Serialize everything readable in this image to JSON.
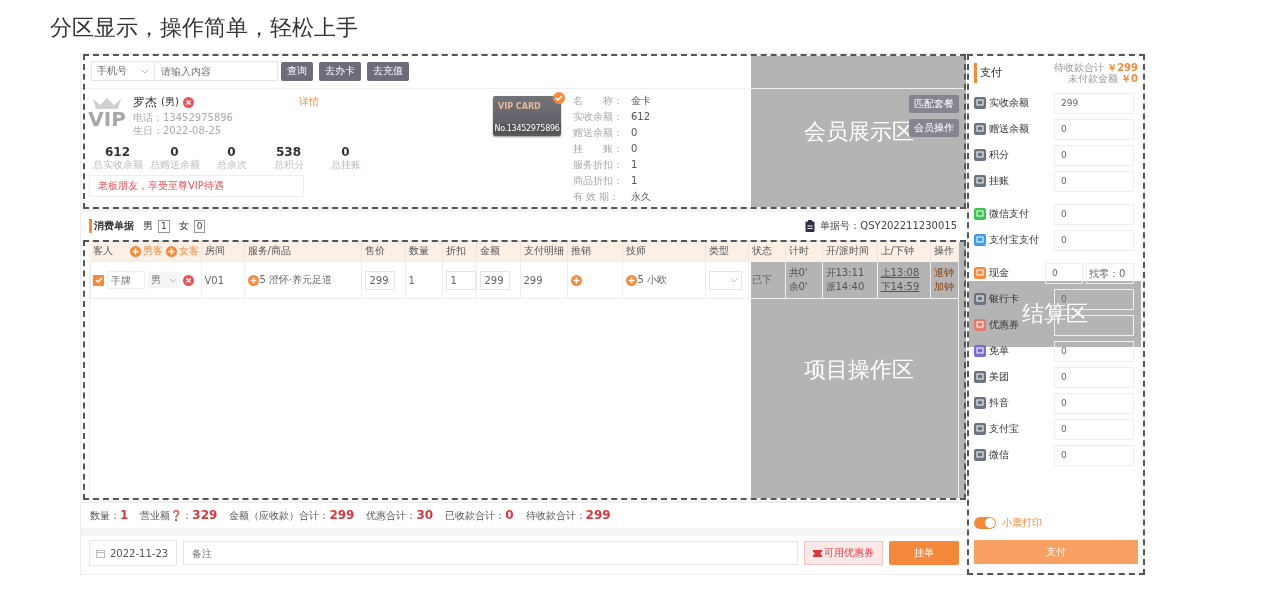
{
  "headline": "分区显示，操作简单，轻松上手",
  "search": {
    "filter": "手机号",
    "placeholder": "请输入内容",
    "buttons": [
      "查询",
      "去办卡",
      "去充值"
    ]
  },
  "member": {
    "logo_text": "VIP",
    "name": "罗杰",
    "gender": "(男)",
    "detail_link": "详情",
    "phone": "电话：13452975896",
    "birthday": "生日：2022-08-25",
    "stats": [
      {
        "value": "612",
        "label": "总实收余额"
      },
      {
        "value": "0",
        "label": "总赠送余额"
      },
      {
        "value": "0",
        "label": "总余次"
      },
      {
        "value": "538",
        "label": "总积分"
      },
      {
        "value": "0",
        "label": "总挂账"
      }
    ],
    "note": "老板朋友，享受至尊VIP待遇",
    "card": {
      "title": "VIP CARD",
      "number": "No.13452975896",
      "selected": true
    },
    "info": [
      {
        "label": "名　　称：",
        "value": "金卡"
      },
      {
        "label": "实收余额：",
        "value": "612"
      },
      {
        "label": "赠送余额：",
        "value": "0"
      },
      {
        "label": "挂　　账：",
        "value": "0"
      },
      {
        "label": "服务折扣：",
        "value": "1"
      },
      {
        "label": "商品折扣：",
        "value": "1"
      },
      {
        "label": "有 效 期：",
        "value": "永久"
      }
    ],
    "actions": [
      "匹配套餐",
      "会员操作"
    ]
  },
  "bill": {
    "title": "消费单据",
    "counts": [
      {
        "label": "男",
        "value": "1"
      },
      {
        "label": "女",
        "value": "0"
      }
    ],
    "number": "单据号：QSY202211230015"
  },
  "table": {
    "columns": [
      "客人",
      "房间",
      "服务/商品",
      "售价",
      "数量",
      "折扣",
      "金额",
      "支付明细",
      "推销",
      "技师",
      "类型",
      "状态",
      "计时",
      "开/派时间",
      "上/下钟",
      "操作"
    ],
    "guest_actions": [
      "男客",
      "女客"
    ],
    "rows": [
      {
        "checked": true,
        "tag_placeholder": "手牌",
        "gender": "男",
        "room": "V01",
        "service": "5 澄怀·养元足道",
        "price": "299",
        "qty": "1",
        "discount": "1",
        "amount": "299",
        "pay_detail": "299",
        "tech": "5 小欧",
        "status": "已下",
        "timing": [
          "共0'",
          "余0'"
        ],
        "times": [
          "开13:11",
          "派14:40"
        ],
        "clock": [
          "上13:08",
          "下14:59"
        ],
        "ops": [
          "退钟",
          "加钟"
        ]
      }
    ]
  },
  "totals": [
    {
      "label": "数量：",
      "value": "1"
    },
    {
      "label": "营业额❓：",
      "value": "329"
    },
    {
      "label": "金额（应收款）合计：",
      "value": "299"
    },
    {
      "label": "优惠合计：",
      "value": "30"
    },
    {
      "label": "已收款合计：",
      "value": "0"
    },
    {
      "label": "待收款合计：",
      "value": "299"
    }
  ],
  "footer": {
    "date": "2022-11-23",
    "remark_placeholder": "备注",
    "coupon_button": "可用优惠券",
    "hold_button": "挂单"
  },
  "payment": {
    "title": "支付",
    "due_label": "待收款合计",
    "due": "￥299",
    "unpaid_label": "未付款金额",
    "unpaid": "￥0",
    "groups": [
      {
        "methods": [
          {
            "label": "实收余额",
            "value": "299",
            "color": "#6b7280"
          },
          {
            "label": "赠送余额",
            "value": "0",
            "color": "#6b7280"
          },
          {
            "label": "积分",
            "value": "0",
            "color": "#6b7280"
          },
          {
            "label": "挂账",
            "value": "0",
            "color": "#6b7280"
          }
        ]
      },
      {
        "methods": [
          {
            "label": "微信支付",
            "value": "0",
            "color": "#3cc251"
          },
          {
            "label": "支付宝支付",
            "value": "0",
            "color": "#3d9be9"
          }
        ]
      },
      {
        "methods": [
          {
            "label": "现金",
            "value": "0",
            "color": "#f38b3c",
            "change": "找零：0"
          },
          {
            "label": "银行卡",
            "value": "0",
            "color": "#6b7280"
          },
          {
            "label": "优惠券",
            "color": "#e27b6b"
          },
          {
            "label": "免单",
            "value": "0",
            "color": "#7b6bd0"
          },
          {
            "label": "美团",
            "value": "0",
            "color": "#6b7280"
          },
          {
            "label": "抖音",
            "value": "0",
            "color": "#6b7280"
          },
          {
            "label": "支付宝",
            "value": "0",
            "color": "#6b7280"
          },
          {
            "label": "微信",
            "value": "0",
            "color": "#6b7280"
          }
        ]
      }
    ],
    "print": {
      "label": "小票打印",
      "on": true
    },
    "pay_button": "支付"
  },
  "zones": [
    {
      "kind": "member",
      "label": "会员展示区"
    },
    {
      "kind": "project",
      "label": "项目操作区"
    },
    {
      "kind": "settle",
      "label": "结算区"
    }
  ]
}
